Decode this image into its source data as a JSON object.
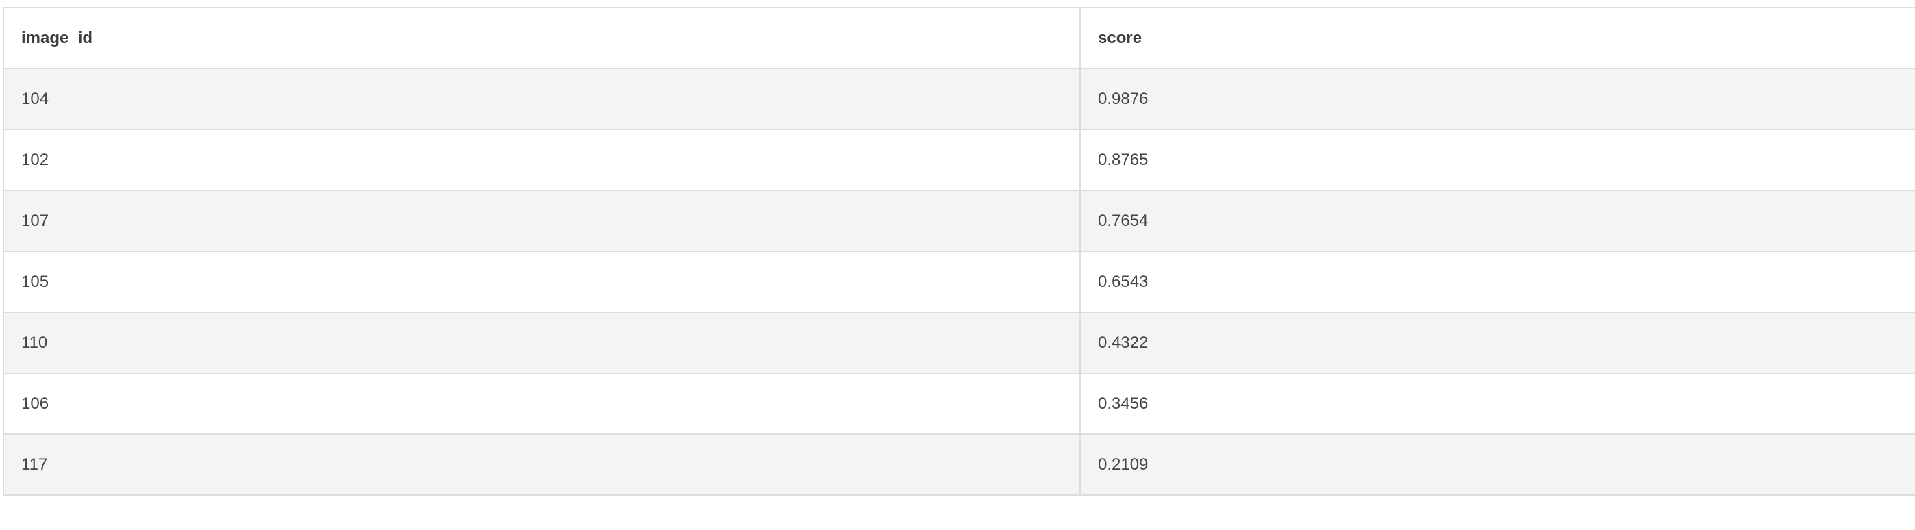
{
  "table": {
    "columns": [
      "image_id",
      "score"
    ],
    "rows": [
      [
        "104",
        "0.9876"
      ],
      [
        "102",
        "0.8765"
      ],
      [
        "107",
        "0.7654"
      ],
      [
        "105",
        "0.6543"
      ],
      [
        "110",
        "0.4322"
      ],
      [
        "106",
        "0.3456"
      ],
      [
        "117",
        "0.2109"
      ]
    ]
  }
}
